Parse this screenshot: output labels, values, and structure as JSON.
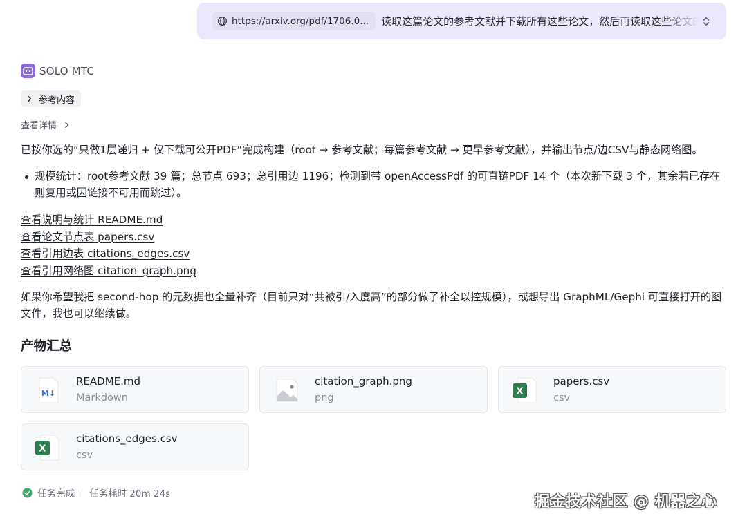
{
  "prompt": {
    "url": "https://arxiv.org/pdf/1706.0...",
    "text": "读取这篇论文的参考文献并下载所有这些论文，然后再读取这些论文的参考文献"
  },
  "agent": {
    "name": "SOLO MTC",
    "references_label": "参考内容",
    "details_label": "查看详情"
  },
  "message": {
    "intro": "已按你选的“只做1层递归 + 仅下载可公开PDF”完成构建（root → 参考文献；每篇参考文献 → 更早参考文献），并输出节点/边CSV与静态网络图。",
    "bullet": "规模统计：root参考文献 39 篇；总节点 693；总引用边 1196；检测到带 openAccessPdf 的可直链PDF 14 个（本次新下载 3 个，其余若已存在则复用或因链接不可用而跳过）。",
    "links": [
      "查看说明与统计 README.md",
      "查看论文节点表 papers.csv",
      "查看引用边表 citations_edges.csv",
      "查看引用网络图 citation_graph.png"
    ],
    "followup": "如果你希望我把 second-hop 的元数据也全量补齐（目前只对“共被引/入度高”的部分做了补全以控规模），或想导出 GraphML/Gephi 可直接打开的图文件，我也可以继续做。"
  },
  "artifacts": {
    "title": "产物汇总",
    "files": [
      {
        "name": "README.md",
        "type": "Markdown",
        "icon": "markdown-file-icon"
      },
      {
        "name": "citation_graph.png",
        "type": "png",
        "icon": "image-file-icon"
      },
      {
        "name": "papers.csv",
        "type": "csv",
        "icon": "excel-file-icon"
      },
      {
        "name": "citations_edges.csv",
        "type": "csv",
        "icon": "excel-file-icon"
      }
    ]
  },
  "status": {
    "done": "任务完成",
    "elapsed": "任务耗时 20m 24s"
  },
  "watermark": "掘金技术社区 @ 机器之心",
  "colors": {
    "prompt_bg": "#ebe8fb",
    "agent_logo": "#8b6ad9",
    "success": "#3aa76d",
    "excel_green": "#2e7d4f",
    "markdown_blue": "#3b73d9"
  }
}
